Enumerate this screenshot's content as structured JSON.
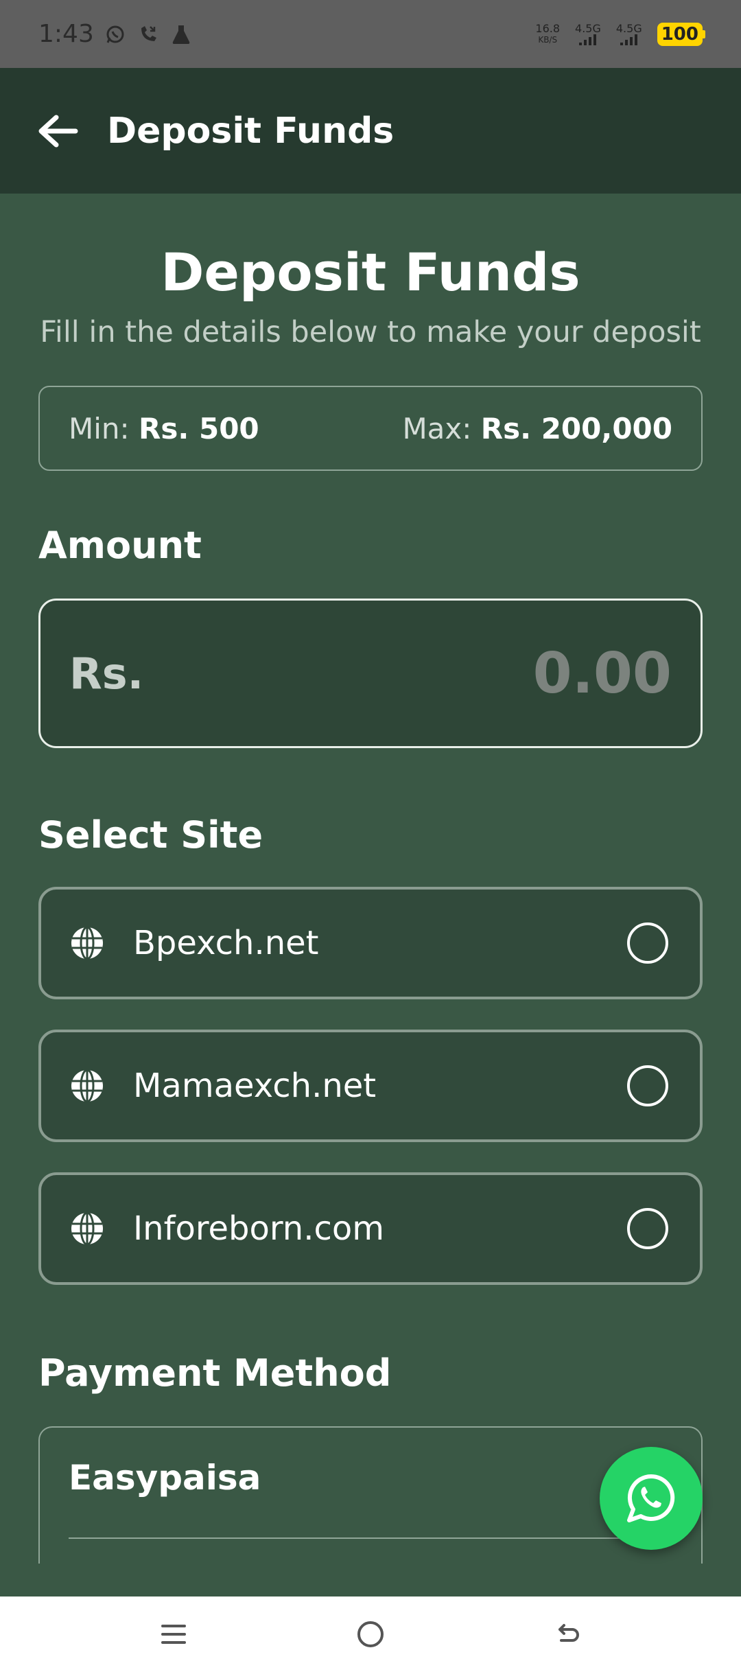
{
  "status_bar": {
    "time": "1:43",
    "net_speed": "16.8",
    "net_speed_unit": "KB/S",
    "signal1": "4.5G",
    "signal2": "4.5G",
    "battery": "100"
  },
  "app_bar": {
    "title": "Deposit Funds"
  },
  "header": {
    "title": "Deposit Funds",
    "subtitle": "Fill in the details below to make your deposit"
  },
  "limits": {
    "min_label": "Min:",
    "min_value": "Rs. 500",
    "max_label": "Max:",
    "max_value": "Rs. 200,000"
  },
  "amount": {
    "label": "Amount",
    "currency": "Rs.",
    "placeholder": "0.00"
  },
  "site": {
    "label": "Select Site",
    "options": [
      {
        "name": "Bpexch.net"
      },
      {
        "name": "Mamaexch.net"
      },
      {
        "name": "Inforeborn.com"
      }
    ]
  },
  "payment": {
    "label": "Payment Method",
    "methods": [
      {
        "name": "Easypaisa"
      }
    ]
  },
  "colors": {
    "background": "#3a5845",
    "app_bar": "#263a2f",
    "whatsapp": "#25d366",
    "battery": "#ffd400"
  }
}
